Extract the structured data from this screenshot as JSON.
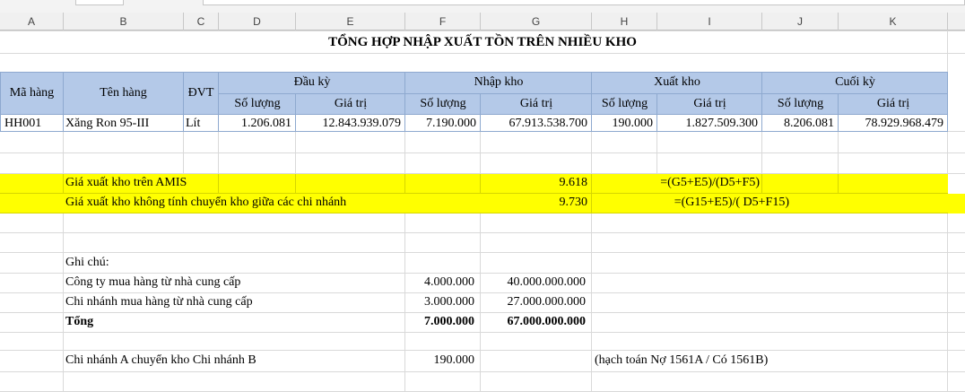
{
  "columns": [
    "A",
    "B",
    "C",
    "D",
    "E",
    "F",
    "G",
    "H",
    "I",
    "J",
    "K"
  ],
  "title": "TỔNG HỢP NHẬP XUẤT TỒN TRÊN NHIỀU KHO",
  "table": {
    "header": {
      "ma_hang": "Mã hàng",
      "ten_hang": "Tên hàng",
      "dvt": "ĐVT",
      "dau_ky": "Đầu kỳ",
      "nhap_kho": "Nhập kho",
      "xuat_kho": "Xuất kho",
      "cuoi_ky": "Cuối kỳ",
      "so_luong": "Số lượng",
      "gia_tri": "Giá trị"
    },
    "row": {
      "ma_hang": "HH001",
      "ten_hang": "Xăng Ron 95-III",
      "dvt": "Lít",
      "dau_ky_sl": "1.206.081",
      "dau_ky_gt": "12.843.939.079",
      "nhap_sl": "7.190.000",
      "nhap_gt": "67.913.538.700",
      "xuat_sl": "190.000",
      "xuat_gt": "1.827.509.300",
      "cuoi_sl": "8.206.081",
      "cuoi_gt": "78.929.968.479"
    }
  },
  "price_rows": [
    {
      "label": "Giá xuất kho trên AMIS",
      "value": "9.618",
      "formula": "=(G5+E5)/(D5+F5)"
    },
    {
      "label": "Giá xuất kho không tính chuyển kho giữa các chi nhánh",
      "value": "9.730",
      "formula": "=(G15+E5)/( D5+F15)"
    }
  ],
  "notes": {
    "heading": "Ghi chú:",
    "rows": [
      {
        "label": "Công ty mua hàng từ nhà cung cấp",
        "qty": "4.000.000",
        "value": "40.000.000.000"
      },
      {
        "label": "Chi nhánh mua hàng từ nhà cung cấp",
        "qty": "3.000.000",
        "value": "27.000.000.000"
      }
    ],
    "total": {
      "label": "Tổng",
      "qty": "7.000.000",
      "value": "67.000.000.000"
    },
    "transfer": {
      "label": "Chi nhánh A chuyển kho Chi nhánh B",
      "qty": "190.000",
      "note": "(hạch toán Nợ 1561A / Có 1561B)"
    }
  }
}
